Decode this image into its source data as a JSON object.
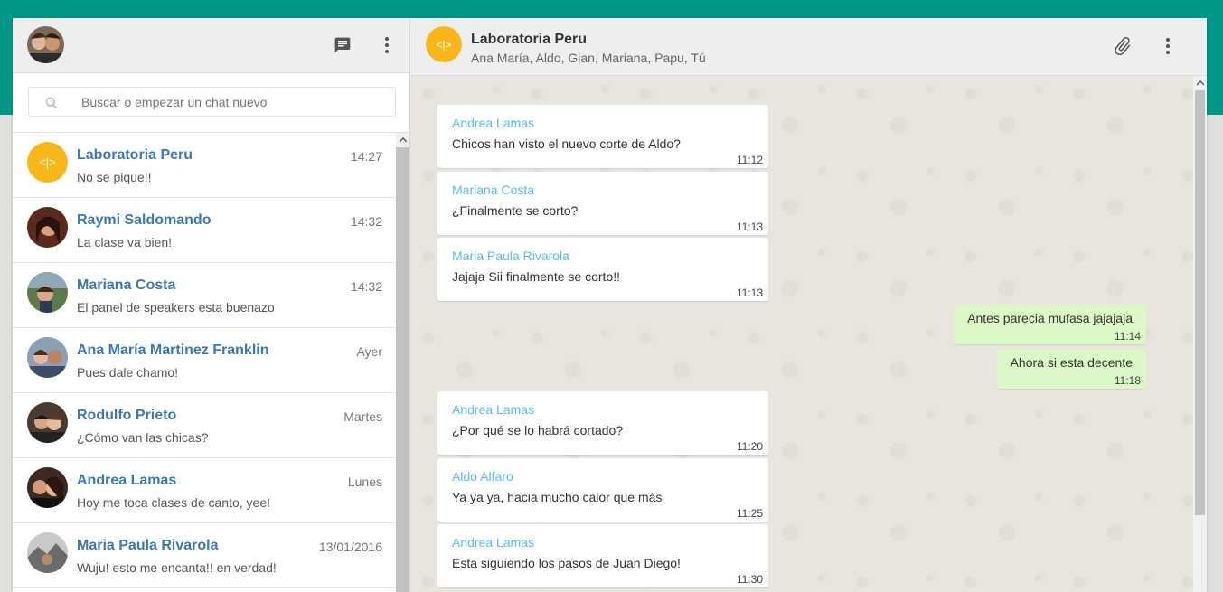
{
  "colors": {
    "brand": "#009688",
    "sender": "#5ebce6",
    "chat_name": "#3b79b5",
    "outgoing_bubble": "#dcf8c6"
  },
  "left_header": {
    "icons": [
      "new-chat-icon",
      "menu-dots-icon"
    ]
  },
  "search": {
    "placeholder": "Buscar o empezar un chat nuevo"
  },
  "chats": [
    {
      "name": "Laboratoria Peru",
      "time": "14:27",
      "preview": "No se pique!!"
    },
    {
      "name": "Raymi Saldomando",
      "time": "14:32",
      "preview": "La clase va bien!"
    },
    {
      "name": "Mariana Costa",
      "time": "14:32",
      "preview": "El panel de speakers esta buenazo"
    },
    {
      "name": "Ana María Martinez Franklin",
      "time": "Ayer",
      "preview": "Pues dale chamo!"
    },
    {
      "name": "Rodulfo Prieto",
      "time": "Martes",
      "preview": "¿Cómo van las chicas?"
    },
    {
      "name": "Andrea Lamas",
      "time": "Lunes",
      "preview": "Hoy me toca clases de canto, yee!"
    },
    {
      "name": "Maria Paula Rivarola",
      "time": "13/01/2016",
      "preview": "Wuju! esto me encanta!! en verdad!"
    }
  ],
  "conversation": {
    "title": "Laboratoria Peru",
    "members": "Ana María, Aldo, Gian, Mariana, Papu, Tú",
    "logo_text": "<|>",
    "header_icons": [
      "attach-icon",
      "menu-dots-icon"
    ]
  },
  "messages": [
    {
      "sender": "Andrea Lamas",
      "text": "Chicos han visto el nuevo corte de Aldo?",
      "time": "11:12"
    },
    {
      "sender": "Mariana Costa",
      "text": "¿Finalmente se corto?",
      "time": "11:13"
    },
    {
      "sender": "Maria Paula Rivarola",
      "text": "Jajaja Sii finalmente se corto!!",
      "time": "11:13"
    },
    {
      "sender": "",
      "text": "Antes parecia mufasa jajajaja",
      "time": "11:14"
    },
    {
      "sender": "",
      "text": "Ahora si esta decente",
      "time": "11:18"
    },
    {
      "sender": "Andrea Lamas",
      "text": "¿Por qué se lo habrá cortado?",
      "time": "11:20"
    },
    {
      "sender": "Aldo Alfaro",
      "text": "Ya ya ya, hacia mucho calor que más",
      "time": "11:25"
    },
    {
      "sender": "Andrea Lamas",
      "text": "Esta siguiendo los pasos de Juan Diego!",
      "time": "11:30"
    }
  ]
}
